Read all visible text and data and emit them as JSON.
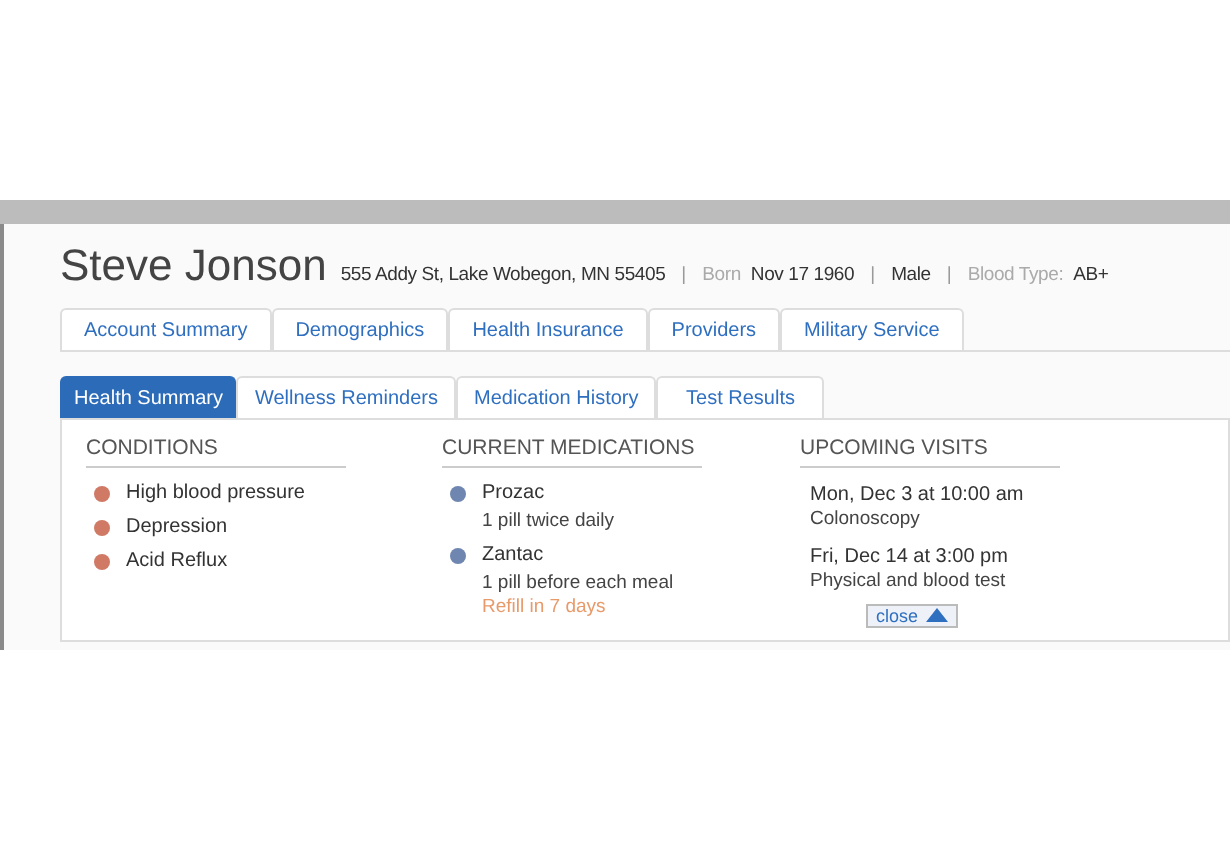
{
  "patient": {
    "name": "Steve Jonson",
    "address": "555 Addy St, Lake Wobegon, MN 55405",
    "born_label": "Born",
    "born": "Nov 17 1960",
    "sex": "Male",
    "blood_type_label": "Blood Type:",
    "blood_type": "AB+",
    "separator": "|"
  },
  "tabs": [
    {
      "label": "Account Summary",
      "selected": false
    },
    {
      "label": "Demographics",
      "selected": false
    },
    {
      "label": "Health Insurance",
      "selected": false
    },
    {
      "label": "Providers",
      "selected": false
    },
    {
      "label": "Military Service",
      "selected": false
    }
  ],
  "subtabs": [
    {
      "label": "Health Summary",
      "selected": true
    },
    {
      "label": "Wellness Reminders",
      "selected": false
    },
    {
      "label": "Medication History",
      "selected": false
    },
    {
      "label": "Test Results",
      "selected": false
    }
  ],
  "conditions": {
    "title": "CONDITIONS",
    "items": [
      {
        "name": "High blood pressure",
        "color": "#d07a66"
      },
      {
        "name": "Depression",
        "color": "#d07a66"
      },
      {
        "name": "Acid Reflux",
        "color": "#d07a66"
      }
    ]
  },
  "medications": {
    "title": "CURRENT MEDICATIONS",
    "items": [
      {
        "name": "Prozac",
        "dose": "1 pill twice daily",
        "color": "#6f86b0"
      },
      {
        "name": "Zantac",
        "dose": "1 pill before each meal",
        "refill": "Refill in 7 days",
        "color": "#6f86b0"
      }
    ]
  },
  "visits": {
    "title": "UPCOMING VISITS",
    "items": [
      {
        "when": "Mon, Dec 3 at 10:00 am",
        "what": "Colonoscopy"
      },
      {
        "when": "Fri, Dec 14 at 3:00 pm",
        "what": "Physical and blood test"
      }
    ]
  },
  "close_button": "close"
}
